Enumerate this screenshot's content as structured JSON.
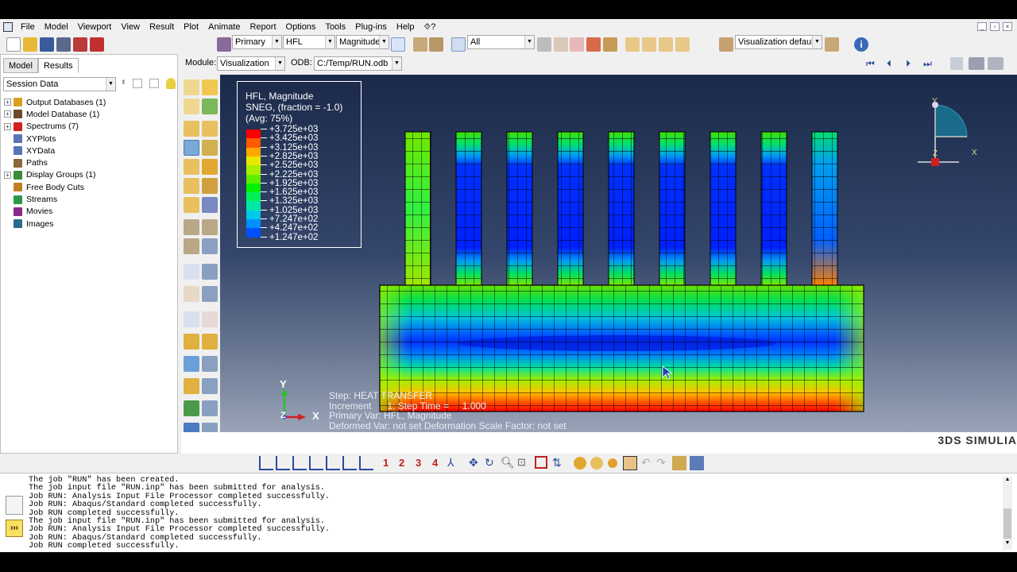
{
  "menu": [
    "File",
    "Model",
    "Viewport",
    "View",
    "Result",
    "Plot",
    "Animate",
    "Report",
    "Options",
    "Tools",
    "Plug-ins",
    "Help",
    "⯑?"
  ],
  "toolbar": {
    "step_combo": "Primary",
    "variable_combo": "HFL",
    "invariant_combo": "Magnitude",
    "selection_combo": "All",
    "visualization_combo": "Visualization defaults"
  },
  "context": {
    "module_label": "Module:",
    "module_value": "Visualization",
    "odb_label": "ODB:",
    "odb_value": "C:/Temp/RUN.odb"
  },
  "tabs": [
    "Model",
    "Results"
  ],
  "session_combo": "Session Data",
  "tree": [
    {
      "label": "Output Databases (1)",
      "expand": true,
      "icon": "database-icon",
      "color": "#d8a020"
    },
    {
      "label": "Model Database (1)",
      "expand": true,
      "icon": "model-database-icon",
      "color": "#6a4a2a"
    },
    {
      "label": "Spectrums (7)",
      "expand": true,
      "icon": "spectrum-icon",
      "color": "#d02020"
    },
    {
      "label": "XYPlots",
      "expand": false,
      "icon": "xyplot-icon",
      "color": "#5a74b8"
    },
    {
      "label": "XYData",
      "expand": false,
      "icon": "xydata-icon",
      "color": "#5a74b8"
    },
    {
      "label": "Paths",
      "expand": false,
      "icon": "path-icon",
      "color": "#8a6a3a"
    },
    {
      "label": "Display Groups (1)",
      "expand": true,
      "icon": "display-group-icon",
      "color": "#3a8a3a"
    },
    {
      "label": "Free Body Cuts",
      "expand": false,
      "icon": "free-body-icon",
      "color": "#c08020"
    },
    {
      "label": "Streams",
      "expand": false,
      "icon": "stream-icon",
      "color": "#2a9a4a"
    },
    {
      "label": "Movies",
      "expand": false,
      "icon": "movie-icon",
      "color": "#8a2a8a"
    },
    {
      "label": "Images",
      "expand": false,
      "icon": "image-icon",
      "color": "#2a6a8a"
    }
  ],
  "legend": {
    "line1": "HFL, Magnitude",
    "line2": "SNEG, (fraction = -1.0)",
    "line3": "(Avg: 75%)",
    "values": [
      "+3.725e+03",
      "+3.425e+03",
      "+3.125e+03",
      "+2.825e+03",
      "+2.525e+03",
      "+2.225e+03",
      "+1.925e+03",
      "+1.625e+03",
      "+1.325e+03",
      "+1.025e+03",
      "+7.247e+02",
      "+4.247e+02",
      "+1.247e+02"
    ],
    "colors": [
      "#ff0000",
      "#ff5a00",
      "#ffa800",
      "#e8e800",
      "#a8f000",
      "#5af000",
      "#00f000",
      "#00f05a",
      "#00e8a8",
      "#00c8e8",
      "#0090ff",
      "#0050ff",
      "#0000ff"
    ]
  },
  "triad_viewport": {
    "y": "Y",
    "x": "X",
    "z": "Z"
  },
  "triad_corner": {
    "y": "Y",
    "x": "X",
    "z": "Z"
  },
  "step_info": {
    "line1": "Step: HEAT TRANSFER",
    "line2": "Increment      1: Step Time =     1.000",
    "line3": "Primary Var: HFL, Magnitude",
    "line4": "Deformed Var: not set   Deformation Scale Factor: not set"
  },
  "brand": "3DS SIMULIA",
  "nav_numbers": [
    "1",
    "2",
    "3",
    "4"
  ],
  "messages": [
    "The job \"RUN\" has been created.",
    "The job input file \"RUN.inp\" has been submitted for analysis.",
    "Job RUN: Analysis Input File Processor completed successfully.",
    "Job RUN: Abaqus/Standard completed successfully.",
    "Job RUN completed successfully.",
    "The job input file \"RUN.inp\" has been submitted for analysis.",
    "Job RUN: Analysis Input File Processor completed successfully.",
    "Job RUN: Abaqus/Standard completed successfully.",
    "Job RUN completed successfully."
  ],
  "colors": {
    "accent": "#2a6ad0",
    "viewport_top": "#1b2a4a",
    "viewport_bottom": "#9aa4b8"
  }
}
